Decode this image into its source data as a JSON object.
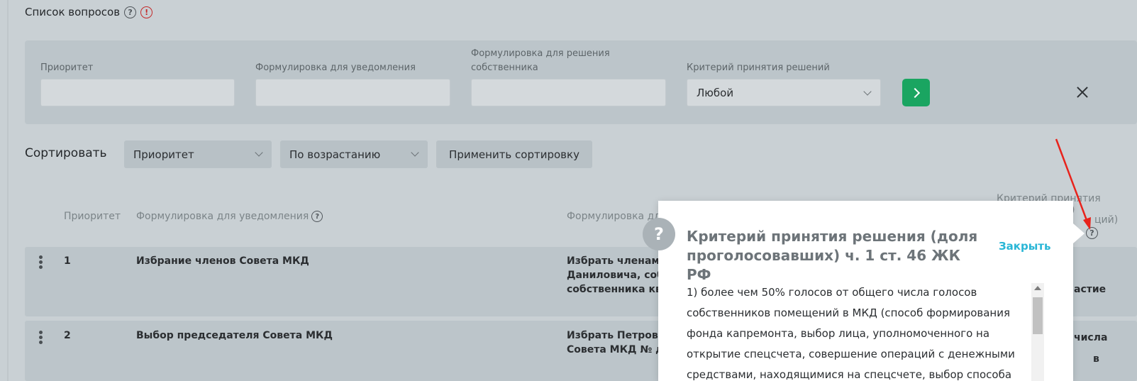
{
  "header": {
    "title": "Список вопросов",
    "help_icon": "question-circle-icon",
    "warning_icon": "exclamation-circle-icon"
  },
  "filters": {
    "priority_label": "Приоритет",
    "notice_label": "Формулировка для уведомления",
    "owner_label_1": "Формулировка для решения",
    "owner_label_2": "собственника",
    "criterion_label": "Критерий принятия решений",
    "criterion_value": "Любой",
    "apply_icon": "chevron-right-icon",
    "clear_icon": "close-icon"
  },
  "sorting": {
    "label": "Сортировать",
    "field_value": "Приоритет",
    "order_value": "По возрастанию",
    "apply_label": "Применить сортировку"
  },
  "table": {
    "col_priority": "Приоритет",
    "col_notice": "Формулировка для уведомления",
    "col_owner": "Формулировка дл",
    "col_criterion_1": "Критерий принятия",
    "col_criterion_2": ")",
    "col_criterion_3": "ций)",
    "rows": [
      {
        "priority": "1",
        "notice": "Избрание членов Совета МКД",
        "owner_1": "Избрать членами",
        "owner_2": "Даниловича, собс",
        "owner_3": "собственника кв.",
        "criterion": "астие"
      },
      {
        "priority": "2",
        "notice": "Выбор председателя Совета МКД",
        "owner_1": "Избрать Петрова",
        "owner_2": "Совета МКД № д.",
        "criterion_1": "числа",
        "criterion_2": "в"
      }
    ]
  },
  "popup": {
    "title": "Критерий принятия решения (доля проголосовавших) ч. 1 ст. 46 ЖК РФ",
    "close_label": "Закрыть",
    "body_lines": [
      "1) более чем 50% голосов от общего числа голосов",
      "собственников помещений в МКД (способ формирования",
      "фонда капремонта, выбор лица, уполномоченного на",
      "открытие спецсчета, совершение операций с денежными",
      "средствами, находящимися на спецсчете, выбор способа"
    ],
    "icon": "question-mark-icon"
  },
  "colors": {
    "accent_green": "#1aa561",
    "link_blue": "#29b6d6",
    "warning_red": "#c42b2b",
    "arrow_red": "#e8231c"
  }
}
